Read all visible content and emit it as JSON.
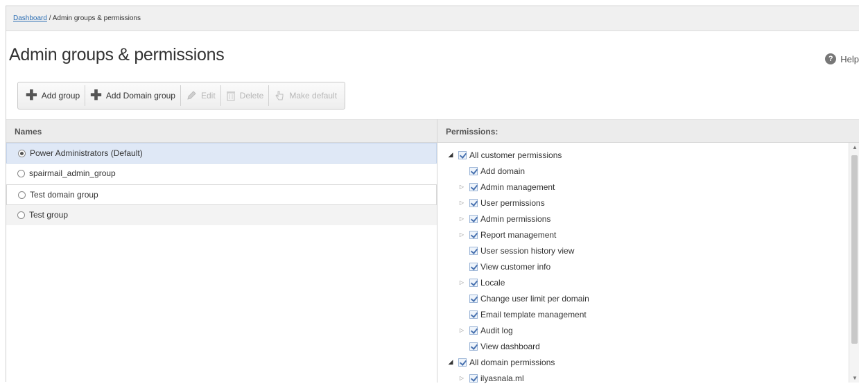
{
  "breadcrumb": {
    "link": "Dashboard",
    "separator": " / ",
    "current": "Admin groups & permissions"
  },
  "page_title": "Admin groups & permissions",
  "help_label": "Help",
  "toolbar": {
    "add_group": "Add group",
    "add_domain_group": "Add Domain group",
    "edit": "Edit",
    "delete": "Delete",
    "make_default": "Make default"
  },
  "names": {
    "header": "Names",
    "rows": [
      {
        "label": "Power Administrators (Default)",
        "selected": true
      },
      {
        "label": "spairmail_admin_group",
        "selected": false
      },
      {
        "label": "Test domain group",
        "selected": false
      },
      {
        "label": "Test group",
        "selected": false
      }
    ]
  },
  "permissions": {
    "header": "Permissions:",
    "tree": [
      {
        "label": "All customer permissions",
        "level": 0,
        "expander": "open",
        "checked": true
      },
      {
        "label": "Add domain",
        "level": 1,
        "expander": "none",
        "checked": true
      },
      {
        "label": "Admin management",
        "level": 1,
        "expander": "closed",
        "checked": true
      },
      {
        "label": "User permissions",
        "level": 1,
        "expander": "closed",
        "checked": true
      },
      {
        "label": "Admin permissions",
        "level": 1,
        "expander": "closed",
        "checked": true
      },
      {
        "label": "Report management",
        "level": 1,
        "expander": "closed",
        "checked": true
      },
      {
        "label": "User session history view",
        "level": 1,
        "expander": "none",
        "checked": true
      },
      {
        "label": "View customer info",
        "level": 1,
        "expander": "none",
        "checked": true
      },
      {
        "label": "Locale",
        "level": 1,
        "expander": "closed",
        "checked": true
      },
      {
        "label": "Change user limit per domain",
        "level": 1,
        "expander": "none",
        "checked": true
      },
      {
        "label": "Email template management",
        "level": 1,
        "expander": "none",
        "checked": true
      },
      {
        "label": "Audit log",
        "level": 1,
        "expander": "closed",
        "checked": true
      },
      {
        "label": "View dashboard",
        "level": 1,
        "expander": "none",
        "checked": true
      },
      {
        "label": "All domain permissions",
        "level": 0,
        "expander": "open",
        "checked": true
      },
      {
        "label": "ilyasnala.ml",
        "level": 1,
        "expander": "closed",
        "checked": true
      }
    ]
  },
  "colors": {
    "link": "#2a6db3",
    "selected_row": "#dfe8f6",
    "header_bg": "#ececec"
  }
}
